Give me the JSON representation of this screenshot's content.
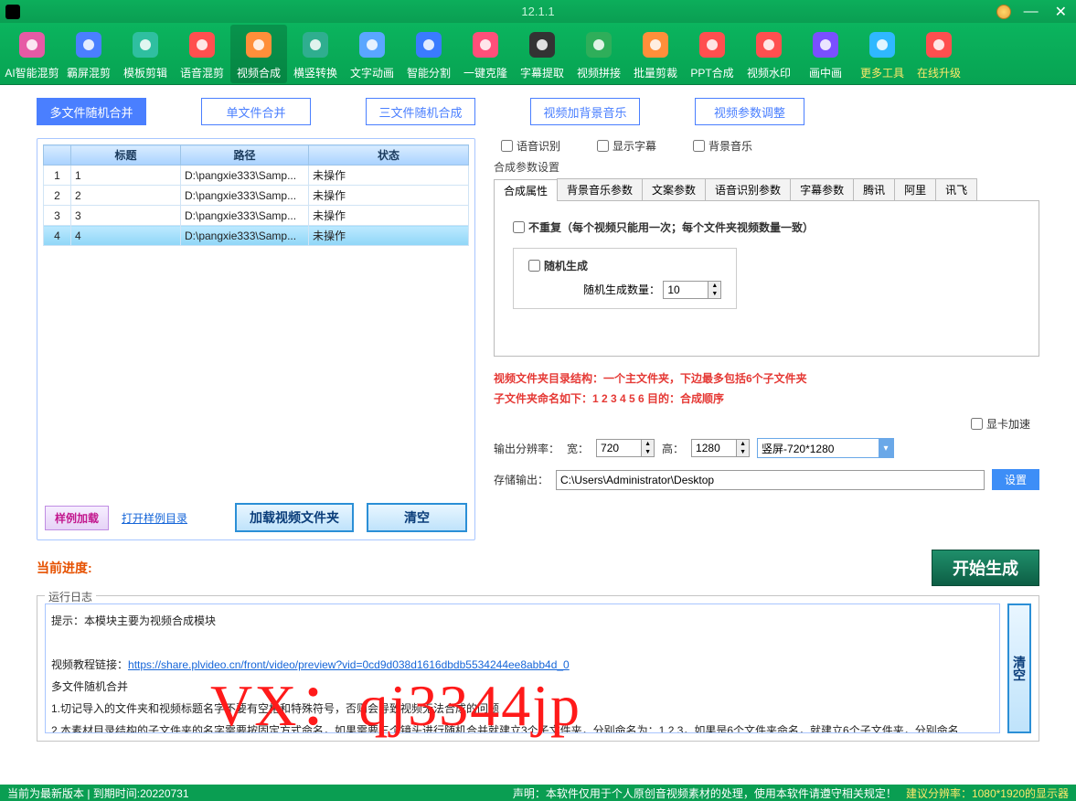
{
  "titlebar": {
    "version": "12.1.1"
  },
  "toolbar": [
    {
      "key": "ai",
      "label": "AI智能混剪",
      "color": "#e65aa5"
    },
    {
      "key": "ba",
      "label": "霸屏混剪",
      "color": "#4a7fff"
    },
    {
      "key": "tpl",
      "label": "模板剪辑",
      "color": "#2fbfa0"
    },
    {
      "key": "voice",
      "label": "语音混剪",
      "color": "#ff4f4f"
    },
    {
      "key": "synth",
      "label": "视频合成",
      "color": "#ff8f3a",
      "active": true
    },
    {
      "key": "hv",
      "label": "横竖转换",
      "color": "#2fae8f"
    },
    {
      "key": "text",
      "label": "文字动画",
      "color": "#5aa6ff"
    },
    {
      "key": "split",
      "label": "智能分割",
      "color": "#3a7bff"
    },
    {
      "key": "clone",
      "label": "一键克隆",
      "color": "#ff4f7a"
    },
    {
      "key": "sub",
      "label": "字幕提取",
      "color": "#333"
    },
    {
      "key": "join",
      "label": "视频拼接",
      "color": "#2fae5a"
    },
    {
      "key": "batch",
      "label": "批量剪裁",
      "color": "#ff8f3a"
    },
    {
      "key": "ppt",
      "label": "PPT合成",
      "color": "#ff4f4f"
    },
    {
      "key": "wm",
      "label": "视频水印",
      "color": "#ff4f4f"
    },
    {
      "key": "pip",
      "label": "画中画",
      "color": "#7a4fff"
    },
    {
      "key": "more",
      "label": "更多工具",
      "color": "#2fb8ff",
      "yellow": true
    },
    {
      "key": "upgrade",
      "label": "在线升级",
      "color": "#ff4f4f",
      "yellow": true
    }
  ],
  "subtabs": {
    "t1": "多文件随机合并",
    "t2": "单文件合并",
    "t3": "三文件随机合成",
    "t4": "视频加背景音乐",
    "t5": "视频参数调整"
  },
  "table": {
    "headers": {
      "h1": "",
      "h2": "标题",
      "h3": "路径",
      "h4": "状态"
    },
    "rows": [
      {
        "n": "1",
        "title": "1",
        "path": "D:\\pangxie333\\Samp...",
        "status": "未操作"
      },
      {
        "n": "2",
        "title": "2",
        "path": "D:\\pangxie333\\Samp...",
        "status": "未操作"
      },
      {
        "n": "3",
        "title": "3",
        "path": "D:\\pangxie333\\Samp...",
        "status": "未操作"
      },
      {
        "n": "4",
        "title": "4",
        "path": "D:\\pangxie333\\Samp...",
        "status": "未操作"
      }
    ]
  },
  "leftbtns": {
    "sample": "样例加载",
    "opendir": "打开样例目录",
    "load": "加载视频文件夹",
    "clear": "清空"
  },
  "checks": {
    "c1": "语音识别",
    "c2": "显示字幕",
    "c3": "背景音乐"
  },
  "params": {
    "grouptitle": "合成参数设置",
    "tabs": {
      "t1": "合成属性",
      "t2": "背景音乐参数",
      "t3": "文案参数",
      "t4": "语音识别参数",
      "t5": "字幕参数",
      "t6": "腾讯",
      "t7": "阿里",
      "t8": "讯飞"
    },
    "norepeat": "不重复（每个视频只能用一次；每个文件夹视频数量一致）",
    "random": "随机生成",
    "randcount_label": "随机生成数量：",
    "randcount": "10"
  },
  "warning": {
    "l1": "视频文件夹目录结构：一个主文件夹，下边最多包括6个子文件夹",
    "l2": "子文件夹命名如下：1 2 3 4 5 6        目的：合成顺序"
  },
  "gpu": "显卡加速",
  "res": {
    "label": "输出分辨率：",
    "w_lbl": "宽：",
    "w": "720",
    "h_lbl": "高：",
    "h": "1280",
    "preset": "竖屏-720*1280"
  },
  "out": {
    "label": "存储输出：",
    "path": "C:\\Users\\Administrator\\Desktop",
    "btn": "设置"
  },
  "progress": "当前进度:",
  "start": "开始生成",
  "log": {
    "legend": "运行日志",
    "tip": "提示：本模块主要为视频合成模块",
    "linklabel": "视频教程链接：",
    "link": "https://share.plvideo.cn/front/video/preview?vid=0cd9d038d1616dbdb5534244ee8abb4d_0",
    "l3": "多文件随机合并",
    "l4": "1.切记导入的文件夹和视频标题名字不要有空格和特殊符号，否则会导致视频无法合成的问题",
    "l5": "2.本素材目录结构的子文件夹的名字需要按固定方式命名，如果需要三个镜头进行随机合并就建立3个子文件夹，分别命名为：1.2.3，如果是6个文件夹命名，就建立6个子文件夹，分别命名",
    "clear": "清空"
  },
  "status": {
    "left": "当前为最新版本 | 到期时间:20220731",
    "disclaimer": "声明：本软件仅用于个人原创音视频素材的处理，使用本软件请遵守相关规定！",
    "res": "建议分辨率：1080*1920的显示器"
  },
  "watermark": "VX：qj3344jp"
}
